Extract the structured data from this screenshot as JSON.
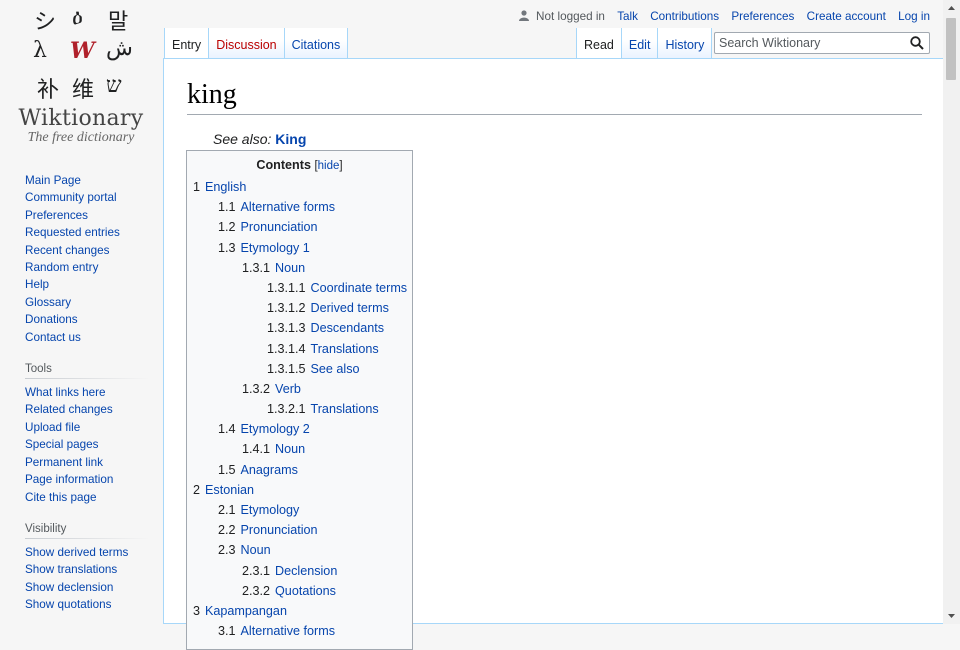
{
  "logo": {
    "glyphs": [
      "シ",
      "ዕ",
      "말",
      "λ",
      "W",
      "ش",
      "补",
      "维",
      "ש"
    ],
    "wordmark": "Wiktionary",
    "tagline": "The free dictionary"
  },
  "sidebar": {
    "navigation": [
      "Main Page",
      "Community portal",
      "Preferences",
      "Requested entries",
      "Recent changes",
      "Random entry",
      "Help",
      "Glossary",
      "Donations",
      "Contact us"
    ],
    "tools_heading": "Tools",
    "tools": [
      "What links here",
      "Related changes",
      "Upload file",
      "Special pages",
      "Permanent link",
      "Page information",
      "Cite this page"
    ],
    "visibility_heading": "Visibility",
    "visibility": [
      "Show derived terms",
      "Show translations",
      "Show declension",
      "Show quotations"
    ]
  },
  "personal": {
    "status": "Not logged in",
    "links": [
      "Talk",
      "Contributions",
      "Preferences",
      "Create account",
      "Log in"
    ]
  },
  "tabs": {
    "left": [
      {
        "label": "Entry",
        "state": "selected"
      },
      {
        "label": "Discussion",
        "state": "new"
      },
      {
        "label": "Citations",
        "state": "normal"
      }
    ],
    "right": [
      {
        "label": "Read",
        "state": "selected"
      },
      {
        "label": "Edit",
        "state": "normal"
      },
      {
        "label": "History",
        "state": "normal"
      }
    ]
  },
  "search": {
    "placeholder": "Search Wiktionary",
    "value": "",
    "icon": "search-icon"
  },
  "page": {
    "title": "king",
    "see_also_label": "See also:",
    "see_also_link": "King"
  },
  "toc": {
    "title": "Contents",
    "hide_open": "[",
    "hide_label": "hide",
    "hide_close": "]",
    "entries": [
      {
        "num": "1",
        "text": "English",
        "level": 1
      },
      {
        "num": "1.1",
        "text": "Alternative forms",
        "level": 2
      },
      {
        "num": "1.2",
        "text": "Pronunciation",
        "level": 2
      },
      {
        "num": "1.3",
        "text": "Etymology 1",
        "level": 2
      },
      {
        "num": "1.3.1",
        "text": "Noun",
        "level": 3
      },
      {
        "num": "1.3.1.1",
        "text": "Coordinate terms",
        "level": 4
      },
      {
        "num": "1.3.1.2",
        "text": "Derived terms",
        "level": 4
      },
      {
        "num": "1.3.1.3",
        "text": "Descendants",
        "level": 4
      },
      {
        "num": "1.3.1.4",
        "text": "Translations",
        "level": 4
      },
      {
        "num": "1.3.1.5",
        "text": "See also",
        "level": 4
      },
      {
        "num": "1.3.2",
        "text": "Verb",
        "level": 3
      },
      {
        "num": "1.3.2.1",
        "text": "Translations",
        "level": 4
      },
      {
        "num": "1.4",
        "text": "Etymology 2",
        "level": 2
      },
      {
        "num": "1.4.1",
        "text": "Noun",
        "level": 3
      },
      {
        "num": "1.5",
        "text": "Anagrams",
        "level": 2
      },
      {
        "num": "2",
        "text": "Estonian",
        "level": 1
      },
      {
        "num": "2.1",
        "text": "Etymology",
        "level": 2
      },
      {
        "num": "2.2",
        "text": "Pronunciation",
        "level": 2
      },
      {
        "num": "2.3",
        "text": "Noun",
        "level": 2
      },
      {
        "num": "2.3.1",
        "text": "Declension",
        "level": 3
      },
      {
        "num": "2.3.2",
        "text": "Quotations",
        "level": 3
      },
      {
        "num": "3",
        "text": "Kapampangan",
        "level": 1
      },
      {
        "num": "3.1",
        "text": "Alternative forms",
        "level": 2
      }
    ]
  },
  "colors": {
    "link": "#0645ad",
    "new_link": "#ba0000",
    "tab_border": "#a7d7f9",
    "background": "#f6f6f6"
  }
}
